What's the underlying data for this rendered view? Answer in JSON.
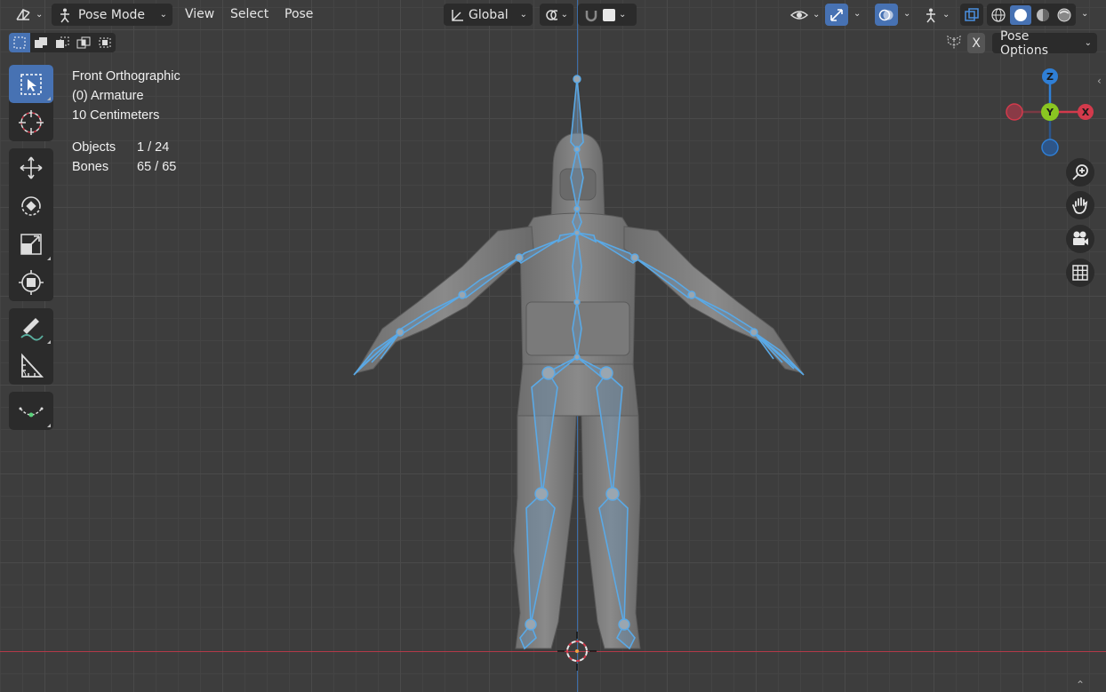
{
  "header": {
    "editor_type_icon": "3d-viewport-icon",
    "mode": "Pose Mode",
    "menus": [
      "View",
      "Select",
      "Pose"
    ],
    "transform_orientation": "Global",
    "pose_options": "Pose Options",
    "x_mirror": "X"
  },
  "select_modes": [
    "set",
    "extend",
    "subtract",
    "difference",
    "intersect"
  ],
  "toolbar": {
    "tools": [
      "select-box",
      "cursor",
      "move",
      "rotate",
      "scale",
      "transform",
      "annotate",
      "measure",
      "relax-pose"
    ]
  },
  "overlay": {
    "view_name": "Front Orthographic",
    "object_name": "(0) Armature",
    "scale": "10 Centimeters",
    "objects_label": "Objects",
    "objects_value": "1 / 24",
    "bones_label": "Bones",
    "bones_value": "65 / 65"
  },
  "gizmo": {
    "z": "Z",
    "y": "Y",
    "x": "X"
  },
  "navigation": [
    "zoom-icon",
    "hand-pan-icon",
    "camera-icon",
    "grid-ortho-icon"
  ],
  "colors": {
    "accent": "#4772b3",
    "bone": "#5aa9e6",
    "axis_x": "#d33a4c",
    "axis_y": "#8ac621",
    "axis_z": "#2f7fd6",
    "background": "#3d3d3d"
  }
}
